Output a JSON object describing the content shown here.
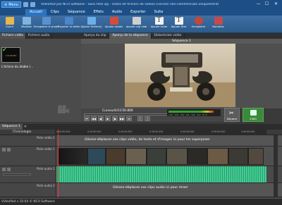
{
  "titlebar": {
    "menu_label": "Menu",
    "title": "VideoPad par NCH Software - Sans titre.vpj - Outils de fichiers de videos (version non-commerciale uniquement)",
    "minimize": "—",
    "maximize": "☐",
    "close": "✕"
  },
  "ribbon_tabs": [
    "Accueil",
    "Clips",
    "Séquence",
    "Effets",
    "Audio",
    "Exporter",
    "Suite"
  ],
  "ribbon": [
    {
      "label": "Ouvrir",
      "color": "#e8b64a"
    },
    {
      "label": "Modèles",
      "color": "#7fb3e0"
    },
    {
      "label": "Enregistrer le projet",
      "color": "#5a8fd0"
    },
    {
      "label": "Exporter la vidéo",
      "color": "#4a86c8"
    },
    {
      "label": "Ajouter fichier(s)",
      "color": "#6ab0e8"
    },
    {
      "label": "Ajouter objets",
      "color": "#d84a3a"
    },
    {
      "label": "Ajouter clip vide",
      "color": "#cfcfcf"
    },
    {
      "label": "Ajouter texte",
      "color": "#f2f2f2"
    },
    {
      "label": "Ajouter titre",
      "color": "#f2f2f2"
    },
    {
      "label": "Enregistrer",
      "color": "#c8453a"
    },
    {
      "label": "Narration",
      "color": "#c64a4a"
    }
  ],
  "left_panel": {
    "tabs": [
      "Fichiers vidéo",
      "Fichiers audio"
    ],
    "clip_label": "L'échine du diable (..."
  },
  "preview": {
    "tabs": [
      "Aperçu du clip",
      "Aperçu de la séquence",
      "Didacticiels vidéo"
    ],
    "sequence_title": "Séquence 1",
    "cursor_label": "Curseur :",
    "cursor_value": "0:03:50.800",
    "meter_scale": "-42 -36 -30 -24 -18 -12 -6 0",
    "split_label": "Séparer",
    "render_label": "2560"
  },
  "timeline": {
    "sequence_tab": "Séquence 1",
    "chronologie": "Chronologie",
    "ruler_ticks": [
      "0:00:00.000",
      "0:10:00.000",
      "0:20:00.000",
      "0:30:00.000",
      "0:40:00.000",
      "0:50:00.000",
      "1:00:00.000"
    ],
    "tracks": {
      "video2": "Piste vidéo 2",
      "video1": "Piste vidéo 1",
      "audio1": "Piste audio 1",
      "audio2": "Piste audio 2"
    },
    "overlay_hint": "Glissez-déplacez vos clips vidéo, de texte et d'images ici pour les superposer",
    "audio_hint": "Glissez-déplacez vos clips audio ici pour mixer"
  },
  "status": {
    "text": "VideoPad v 10.64 © NCH Software"
  }
}
